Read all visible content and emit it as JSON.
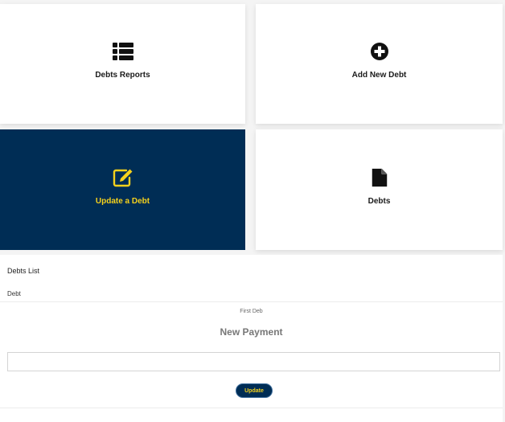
{
  "tiles": {
    "reports": {
      "label": "Debts Reports",
      "icon": "list-icon"
    },
    "add": {
      "label": "Add New Debt",
      "icon": "plus-circle-icon"
    },
    "update": {
      "label": "Update a Debt",
      "icon": "edit-icon",
      "active": true
    },
    "debts": {
      "label": "Debts",
      "icon": "file-icon"
    }
  },
  "debts_list": {
    "title": "Debts List",
    "column_header": "Debt"
  },
  "payment_form": {
    "debt_name": "First Deb",
    "title": "New Payment",
    "amount_value": "",
    "submit_label": "Update"
  },
  "colors": {
    "accent_navy": "#002d55",
    "accent_yellow": "#f5d11c"
  }
}
